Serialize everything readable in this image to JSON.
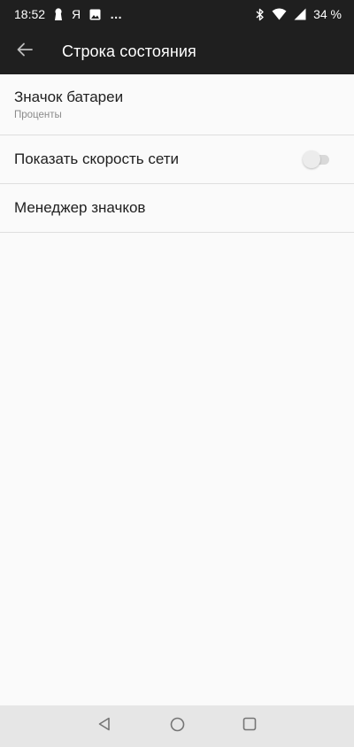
{
  "status_bar": {
    "time": "18:52",
    "app_letter": "Я",
    "more": "…",
    "battery": "34 %",
    "icons": [
      "keyhole-icon",
      "image-icon",
      "bluetooth-icon",
      "wifi-icon",
      "signal-icon"
    ]
  },
  "app_bar": {
    "title": "Строка состояния",
    "back_icon": "arrow-left-icon"
  },
  "settings": {
    "battery_icon": {
      "title": "Значок батареи",
      "summary": "Проценты"
    },
    "network_speed": {
      "title": "Показать скорость сети",
      "enabled": false
    },
    "icon_manager": {
      "title": "Менеджер значков"
    }
  },
  "navigation": {
    "buttons": [
      "back-triangle-icon",
      "home-circle-icon",
      "recents-square-icon"
    ]
  },
  "colors": {
    "bar_background": "#1f1f1f",
    "page_background": "#fafafa",
    "divider": "#dedede",
    "nav_background": "#e6e6e6"
  }
}
